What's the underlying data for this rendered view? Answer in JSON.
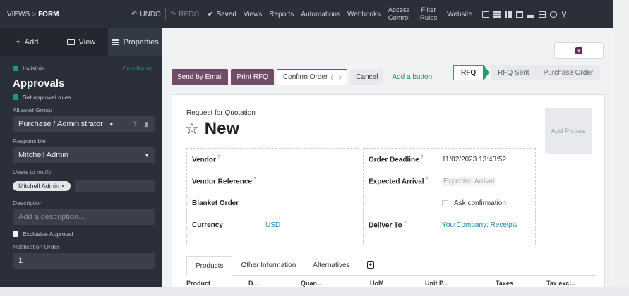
{
  "topbar": {
    "breadcrumb": [
      "VIEWS",
      "FORM"
    ],
    "breadcrumb_sep": ">",
    "undo": "UNDO",
    "redo": "REDO",
    "saved": "Saved",
    "menu": [
      "Views",
      "Reports",
      "Automations",
      "Webhooks",
      "Access Control",
      "Filter Rules",
      "Website"
    ],
    "icons": [
      "form-view-icon",
      "list-view-icon",
      "kanban-view-icon",
      "calendar-view-icon",
      "graph-view-icon",
      "pivot-view-icon",
      "activity-view-icon",
      "search-view-icon"
    ]
  },
  "sidebar": {
    "tabs": [
      {
        "icon": "plus-icon",
        "label": "Add"
      },
      {
        "icon": "monitor-icon",
        "label": "View"
      },
      {
        "icon": "list-icon",
        "label": "Properties"
      }
    ],
    "invisible_label": "Invisible",
    "conditional_label": "Conditional",
    "section_title": "Approvals",
    "set_rules_label": "Set approval rules",
    "allowed_group_label": "Allowed Group",
    "allowed_group_value": "Purchase / Administrator",
    "responsible_label": "Responsible",
    "responsible_value": "Mitchell Admin",
    "users_label": "Users to notify",
    "users_tag": "Mitchell Admin ×",
    "description_label": "Description",
    "description_placeholder": "Add a description...",
    "exclusive_label": "Exclusive Approval",
    "notification_order_label": "Notification Order",
    "notification_order_value": "1"
  },
  "main": {
    "actions": [
      "Send by Email",
      "Print RFQ",
      "Confirm Order",
      "Cancel",
      "Add a button"
    ],
    "stages": [
      "RFQ",
      "RFQ Sent",
      "Purchase Order"
    ],
    "doc_type": "Request for Quotation",
    "title": "New",
    "add_picture": "Add Picture",
    "left_fields": [
      {
        "label": "Vendor",
        "value": ""
      },
      {
        "label": "Vendor Reference",
        "value": ""
      },
      {
        "label": "Blanket Order",
        "value": ""
      },
      {
        "label": "Currency",
        "value": "USD"
      }
    ],
    "right_fields": {
      "order_deadline_label": "Order Deadline",
      "order_deadline_value": "11/02/2023 13:43:52",
      "expected_arrival_label": "Expected Arrival",
      "expected_arrival_placeholder": "Expected Arrival",
      "ask_confirmation": "Ask confirmation",
      "deliver_to_label": "Deliver To",
      "deliver_to_value": "YourCompany: Receipts"
    },
    "tabs": [
      "Products",
      "Other Information",
      "Alternatives"
    ],
    "columns": [
      "Product",
      "D...",
      "Quan...",
      "UoM",
      "Unit P...",
      "Taxes",
      "Tax excl..."
    ]
  },
  "colors": {
    "primary": "#714b67",
    "success": "#1f9a6e",
    "link": "#1b8ab3",
    "dark": "#2b2f3a"
  }
}
